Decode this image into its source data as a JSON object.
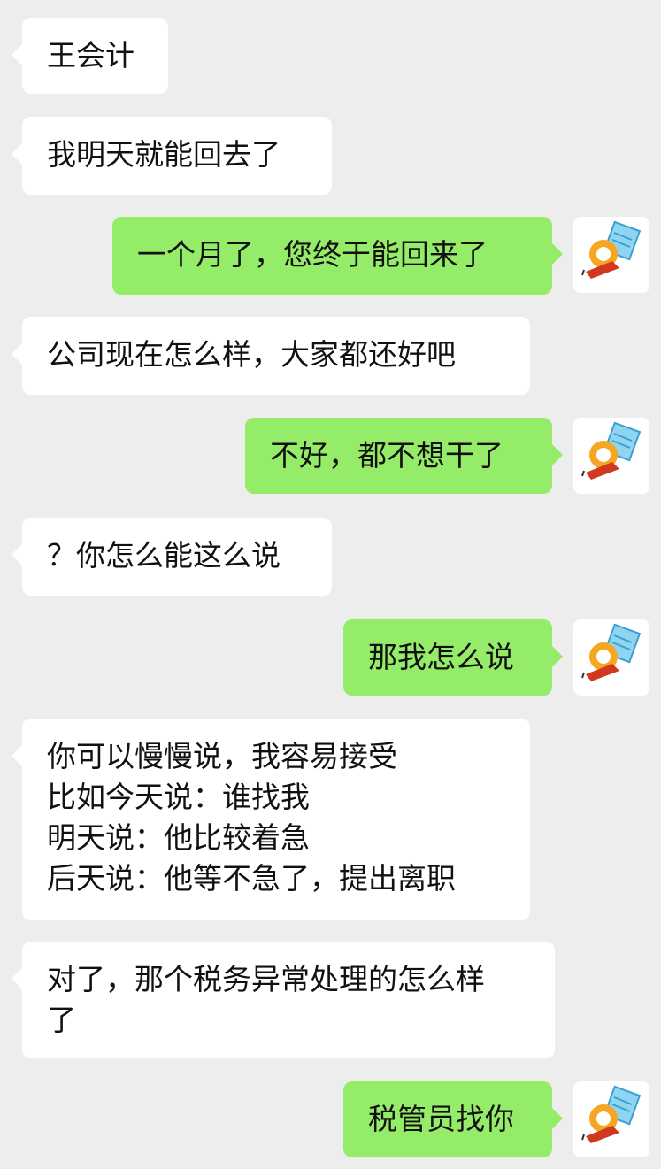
{
  "chat": {
    "messages": [
      {
        "side": "left",
        "text": "王会计"
      },
      {
        "side": "left",
        "text": "我明天就能回去了"
      },
      {
        "side": "right",
        "text": "一个月了，您终于能回来了"
      },
      {
        "side": "left",
        "text": "公司现在怎么样，大家都还好吧"
      },
      {
        "side": "right",
        "text": "不好，都不想干了"
      },
      {
        "side": "left",
        "text": "？你怎么能这么说"
      },
      {
        "side": "right",
        "text": "那我怎么说"
      },
      {
        "side": "left",
        "text": "你可以慢慢说，我容易接受\n比如今天说：谁找我\n明天说：他比较着急\n后天说：他等不急了，提出离职"
      },
      {
        "side": "left",
        "text": "对了，那个税务异常处理的怎么样\n了"
      },
      {
        "side": "right",
        "text": "税管员找你"
      }
    ]
  },
  "colors": {
    "background": "#ededed",
    "left_bubble": "#ffffff",
    "right_bubble": "#95ec69"
  },
  "icons": {
    "avatar": "cartoon-avatar-icon"
  }
}
